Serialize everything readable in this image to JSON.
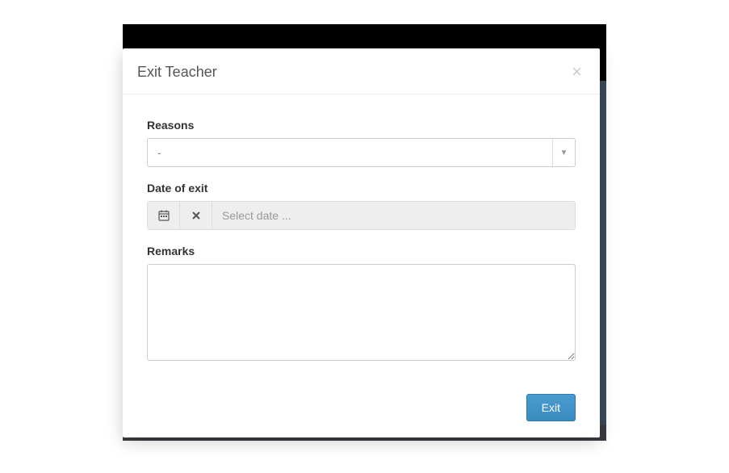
{
  "modal": {
    "title": "Exit Teacher"
  },
  "form": {
    "reasons": {
      "label": "Reasons",
      "value": "-"
    },
    "date_of_exit": {
      "label": "Date of exit",
      "placeholder": "Select date ...",
      "value": ""
    },
    "remarks": {
      "label": "Remarks",
      "value": ""
    }
  },
  "footer": {
    "exit_label": "Exit"
  }
}
